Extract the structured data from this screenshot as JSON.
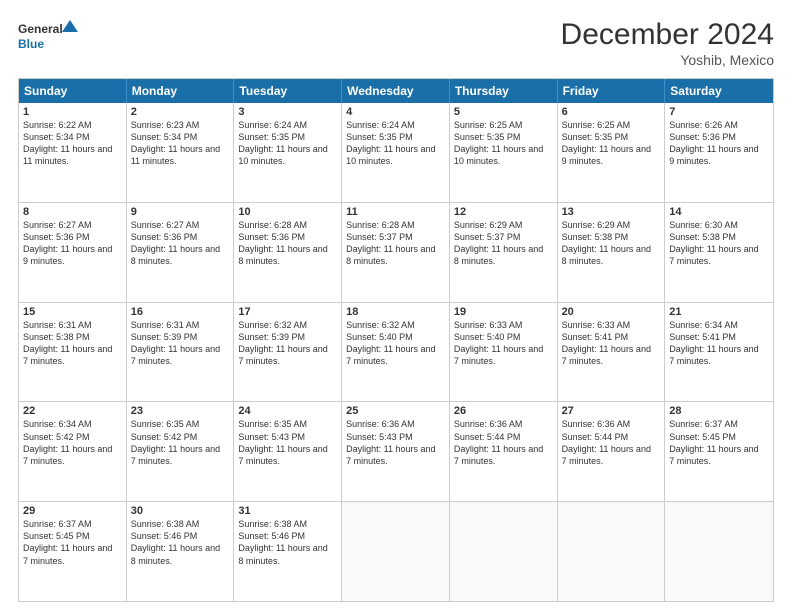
{
  "header": {
    "logo_line1": "General",
    "logo_line2": "Blue",
    "month_title": "December 2024",
    "location": "Yoshib, Mexico"
  },
  "days_of_week": [
    "Sunday",
    "Monday",
    "Tuesday",
    "Wednesday",
    "Thursday",
    "Friday",
    "Saturday"
  ],
  "weeks": [
    [
      {
        "day": "1",
        "sunrise": "6:22 AM",
        "sunset": "5:34 PM",
        "daylight": "11 hours and 11 minutes."
      },
      {
        "day": "2",
        "sunrise": "6:23 AM",
        "sunset": "5:34 PM",
        "daylight": "11 hours and 11 minutes."
      },
      {
        "day": "3",
        "sunrise": "6:24 AM",
        "sunset": "5:35 PM",
        "daylight": "11 hours and 10 minutes."
      },
      {
        "day": "4",
        "sunrise": "6:24 AM",
        "sunset": "5:35 PM",
        "daylight": "11 hours and 10 minutes."
      },
      {
        "day": "5",
        "sunrise": "6:25 AM",
        "sunset": "5:35 PM",
        "daylight": "11 hours and 10 minutes."
      },
      {
        "day": "6",
        "sunrise": "6:25 AM",
        "sunset": "5:35 PM",
        "daylight": "11 hours and 9 minutes."
      },
      {
        "day": "7",
        "sunrise": "6:26 AM",
        "sunset": "5:36 PM",
        "daylight": "11 hours and 9 minutes."
      }
    ],
    [
      {
        "day": "8",
        "sunrise": "6:27 AM",
        "sunset": "5:36 PM",
        "daylight": "11 hours and 9 minutes."
      },
      {
        "day": "9",
        "sunrise": "6:27 AM",
        "sunset": "5:36 PM",
        "daylight": "11 hours and 8 minutes."
      },
      {
        "day": "10",
        "sunrise": "6:28 AM",
        "sunset": "5:36 PM",
        "daylight": "11 hours and 8 minutes."
      },
      {
        "day": "11",
        "sunrise": "6:28 AM",
        "sunset": "5:37 PM",
        "daylight": "11 hours and 8 minutes."
      },
      {
        "day": "12",
        "sunrise": "6:29 AM",
        "sunset": "5:37 PM",
        "daylight": "11 hours and 8 minutes."
      },
      {
        "day": "13",
        "sunrise": "6:29 AM",
        "sunset": "5:38 PM",
        "daylight": "11 hours and 8 minutes."
      },
      {
        "day": "14",
        "sunrise": "6:30 AM",
        "sunset": "5:38 PM",
        "daylight": "11 hours and 7 minutes."
      }
    ],
    [
      {
        "day": "15",
        "sunrise": "6:31 AM",
        "sunset": "5:38 PM",
        "daylight": "11 hours and 7 minutes."
      },
      {
        "day": "16",
        "sunrise": "6:31 AM",
        "sunset": "5:39 PM",
        "daylight": "11 hours and 7 minutes."
      },
      {
        "day": "17",
        "sunrise": "6:32 AM",
        "sunset": "5:39 PM",
        "daylight": "11 hours and 7 minutes."
      },
      {
        "day": "18",
        "sunrise": "6:32 AM",
        "sunset": "5:40 PM",
        "daylight": "11 hours and 7 minutes."
      },
      {
        "day": "19",
        "sunrise": "6:33 AM",
        "sunset": "5:40 PM",
        "daylight": "11 hours and 7 minutes."
      },
      {
        "day": "20",
        "sunrise": "6:33 AM",
        "sunset": "5:41 PM",
        "daylight": "11 hours and 7 minutes."
      },
      {
        "day": "21",
        "sunrise": "6:34 AM",
        "sunset": "5:41 PM",
        "daylight": "11 hours and 7 minutes."
      }
    ],
    [
      {
        "day": "22",
        "sunrise": "6:34 AM",
        "sunset": "5:42 PM",
        "daylight": "11 hours and 7 minutes."
      },
      {
        "day": "23",
        "sunrise": "6:35 AM",
        "sunset": "5:42 PM",
        "daylight": "11 hours and 7 minutes."
      },
      {
        "day": "24",
        "sunrise": "6:35 AM",
        "sunset": "5:43 PM",
        "daylight": "11 hours and 7 minutes."
      },
      {
        "day": "25",
        "sunrise": "6:36 AM",
        "sunset": "5:43 PM",
        "daylight": "11 hours and 7 minutes."
      },
      {
        "day": "26",
        "sunrise": "6:36 AM",
        "sunset": "5:44 PM",
        "daylight": "11 hours and 7 minutes."
      },
      {
        "day": "27",
        "sunrise": "6:36 AM",
        "sunset": "5:44 PM",
        "daylight": "11 hours and 7 minutes."
      },
      {
        "day": "28",
        "sunrise": "6:37 AM",
        "sunset": "5:45 PM",
        "daylight": "11 hours and 7 minutes."
      }
    ],
    [
      {
        "day": "29",
        "sunrise": "6:37 AM",
        "sunset": "5:45 PM",
        "daylight": "11 hours and 7 minutes."
      },
      {
        "day": "30",
        "sunrise": "6:38 AM",
        "sunset": "5:46 PM",
        "daylight": "11 hours and 8 minutes."
      },
      {
        "day": "31",
        "sunrise": "6:38 AM",
        "sunset": "5:46 PM",
        "daylight": "11 hours and 8 minutes."
      },
      null,
      null,
      null,
      null
    ]
  ]
}
